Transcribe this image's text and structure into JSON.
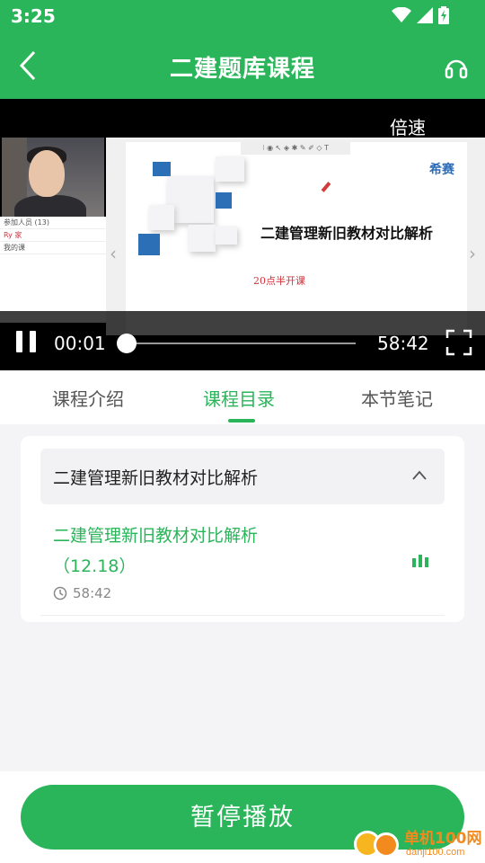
{
  "status_bar": {
    "time": "3:25",
    "icons": [
      "wifi-icon",
      "signal-icon",
      "battery-charging-icon"
    ]
  },
  "header": {
    "title": "二建题库课程"
  },
  "player": {
    "speed_label": "倍速",
    "current_time": "00:01",
    "duration": "58:42",
    "progress": 0.0003,
    "slide": {
      "brand": "希赛",
      "title": "二建管理新旧教材对比解析",
      "subtitle": "20点半开课",
      "toolbar": "⁝ ◉ ↖ ◈ ✱ ✎ ✐ ◇ T"
    },
    "members": [
      "参加人员 (13)",
      "Ry 家",
      "我的课"
    ]
  },
  "tabs": [
    {
      "label": "课程介绍",
      "active": false
    },
    {
      "label": "课程目录",
      "active": true
    },
    {
      "label": "本节笔记",
      "active": false
    }
  ],
  "catalog": {
    "chapter_title": "二建管理新旧教材对比解析",
    "lesson": {
      "title": "二建管理新旧教材对比解析（12.18）",
      "duration": "58:42"
    }
  },
  "bottom_button": {
    "label": "暂停播放"
  },
  "watermark": {
    "name": "单机100网",
    "url": "danji100.com"
  },
  "colors": {
    "accent": "#2bb55a"
  }
}
